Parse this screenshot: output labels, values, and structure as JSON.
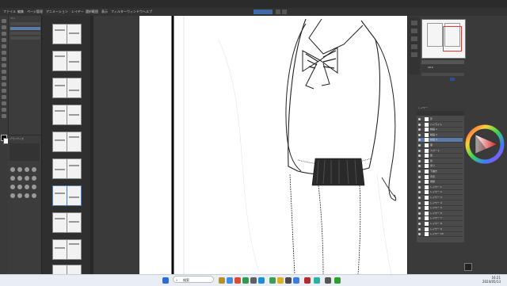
{
  "menu": {
    "items": [
      "ファイル",
      "編集",
      "ページ管理",
      "アニメーション",
      "レイヤー",
      "選択範囲",
      "表示",
      "フィルター",
      "ウィンドウ",
      "ヘルプ"
    ]
  },
  "subtool": {
    "title": "ペン"
  },
  "brush": {
    "title": "ブラシサイズ"
  },
  "navigator": {
    "zoom": "28.6"
  },
  "layers": {
    "title": "レイヤー",
    "items": [
      "影",
      "ハイライト",
      "線画 1",
      "線画 2",
      "線画 3",
      "服",
      "スカート",
      "肌",
      "髪",
      "塗り",
      "下描き",
      "背景",
      "用紙",
      "レイヤー 1",
      "レイヤー 2",
      "レイヤー 3",
      "レイヤー 4",
      "レイヤー 5",
      "レイヤー 6",
      "レイヤー 7",
      "レイヤー 8",
      "レイヤー 9",
      "レイヤー 10"
    ]
  },
  "taskbar": {
    "search_placeholder": "検索",
    "time": "16:21",
    "date": "2024/05/13"
  }
}
